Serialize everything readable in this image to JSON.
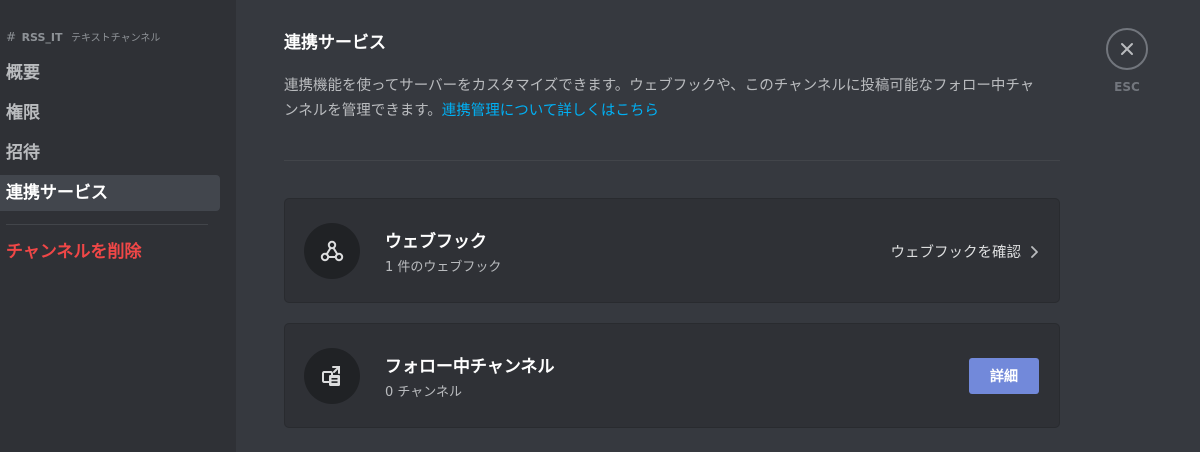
{
  "sidebar": {
    "channel_hash": "#",
    "channel_name": "RSS_IT",
    "channel_type": "テキストチャンネル",
    "items": [
      {
        "label": "概要"
      },
      {
        "label": "権限"
      },
      {
        "label": "招待"
      },
      {
        "label": "連携サービス",
        "active": true
      }
    ],
    "delete_label": "チャンネルを削除"
  },
  "main": {
    "title": "連携サービス",
    "description": "連携機能を使ってサーバーをカスタマイズできます。ウェブフックや、このチャンネルに投稿可能なフォロー中チャンネルを管理できます。",
    "learn_more_link": "連携管理について詳しくはこちら",
    "webhook_card": {
      "title": "ウェブフック",
      "subtitle": "1 件のウェブフック",
      "action_label": "ウェブフックを確認",
      "icon": "webhook-icon"
    },
    "followed_card": {
      "title": "フォロー中チャンネル",
      "subtitle": "0 チャンネル",
      "button_label": "詳細",
      "icon": "followed-channel-icon"
    }
  },
  "close": {
    "esc_label": "ESC",
    "icon": "close-icon"
  },
  "colors": {
    "background": "#36393f",
    "sidebar": "#2f3136",
    "accent": "#7289da",
    "link": "#00b0f4",
    "danger": "#f04747"
  }
}
